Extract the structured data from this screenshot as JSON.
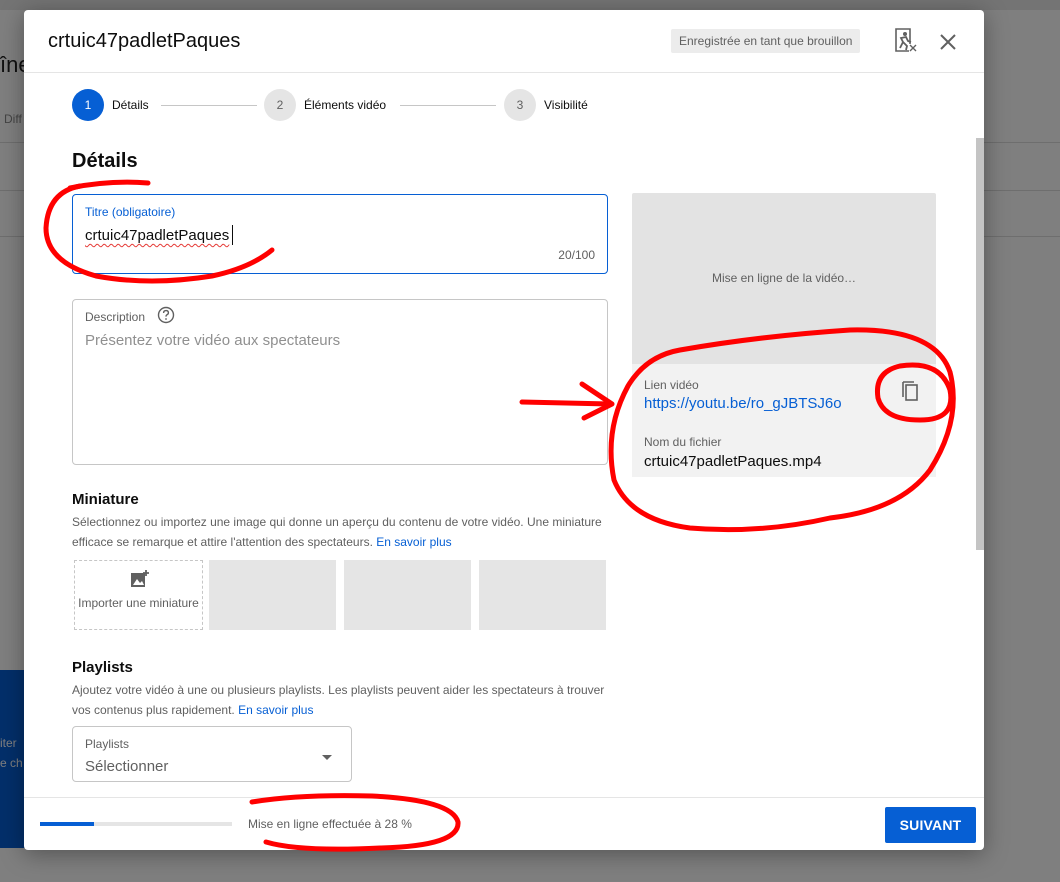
{
  "background": {
    "title_fragment": "îne",
    "small_fragment": "Diff",
    "card_line1": "iter",
    "card_line2": "e ch"
  },
  "dialog": {
    "title": "crtuic47padletPaques",
    "draft_badge": "Enregistrée en tant que brouillon",
    "icons": {
      "issues": "alert-person-icon",
      "close": "close-icon"
    }
  },
  "stepper": {
    "steps": [
      {
        "number": "1",
        "label": "Détails"
      },
      {
        "number": "2",
        "label": "Éléments vidéo"
      },
      {
        "number": "3",
        "label": "Visibilité"
      }
    ]
  },
  "details": {
    "section_title": "Détails",
    "title_field": {
      "label": "Titre (obligatoire)",
      "value": "crtuic47padletPaques",
      "counter": "20/100"
    },
    "description_field": {
      "label": "Description",
      "placeholder": "Présentez votre vidéo aux spectateurs"
    },
    "miniature": {
      "title": "Miniature",
      "description": "Sélectionnez ou importez une image qui donne un aperçu du contenu de votre vidéo. Une miniature efficace se remarque et attire l'attention des spectateurs.",
      "learn_more": "En savoir plus",
      "upload_label": "Importer une miniature"
    },
    "playlists": {
      "title": "Playlists",
      "description": "Ajoutez votre vidéo à une ou plusieurs playlists. Les playlists peuvent aider les spectateurs à trouver vos contenus plus rapidement.",
      "learn_more": "En savoir plus",
      "select_label": "Playlists",
      "select_value": "Sélectionner"
    }
  },
  "preview": {
    "status": "Mise en ligne de la vidéo…",
    "link_label": "Lien vidéo",
    "link": "https://youtu.be/ro_gJBTSJ6o",
    "filename_label": "Nom du fichier",
    "filename": "crtuic47padletPaques.mp4"
  },
  "footer": {
    "upload_progress": 0.28,
    "upload_text": "Mise en ligne effectuée à 28 %",
    "next_button": "SUIVANT"
  },
  "colors": {
    "accent": "#065fd4",
    "annotation": "#ff0000"
  }
}
